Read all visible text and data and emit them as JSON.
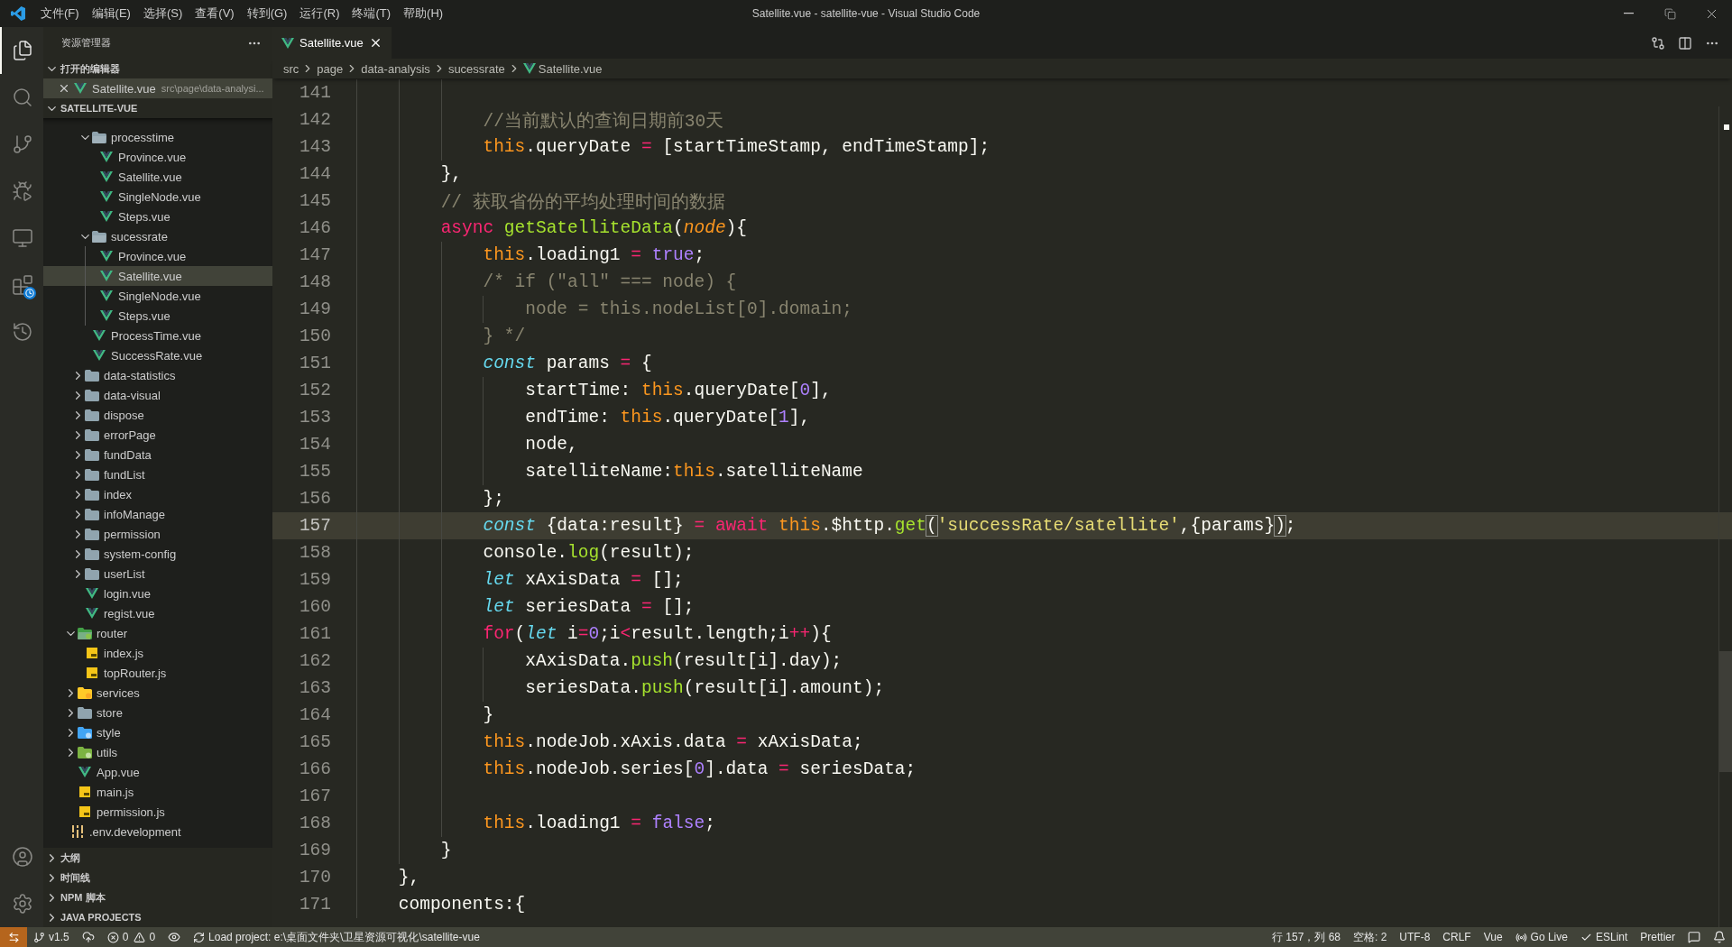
{
  "window": {
    "title": "Satellite.vue - satellite-vue - Visual Studio Code"
  },
  "menu": [
    "文件(F)",
    "编辑(E)",
    "选择(S)",
    "查看(V)",
    "转到(G)",
    "运行(R)",
    "终端(T)",
    "帮助(H)"
  ],
  "activity_bar": [
    {
      "kind": "explorer",
      "selected": true
    },
    {
      "kind": "search",
      "selected": false
    },
    {
      "kind": "scm",
      "selected": false
    },
    {
      "kind": "debug",
      "selected": false
    },
    {
      "kind": "remote",
      "selected": false
    },
    {
      "kind": "extensions",
      "selected": false
    },
    {
      "kind": "history",
      "selected": false
    }
  ],
  "sidebar": {
    "title": "资源管理器",
    "open_editors": {
      "label": "打开的编辑器",
      "expanded": true,
      "items": [
        {
          "name": "Satellite.vue",
          "path": "src\\page\\data-analysi...",
          "kind": "vue",
          "selected": true
        }
      ]
    },
    "project": {
      "label": "SATELLITE-VUE",
      "expanded": true
    },
    "tree": [
      {
        "children": [
          {
            "children": [
              {
                "children": [
                  {
                    "name": "processtime",
                    "kind": "folder",
                    "expanded": true,
                    "selected": false,
                    "children": [
                      {
                        "name": "Province.vue",
                        "kind": "vue",
                        "selected": false
                      },
                      {
                        "name": "Satellite.vue",
                        "kind": "vue",
                        "selected": false
                      },
                      {
                        "name": "SingleNode.vue",
                        "kind": "vue",
                        "selected": false
                      },
                      {
                        "name": "Steps.vue",
                        "kind": "vue",
                        "selected": false
                      }
                    ]
                  },
                  {
                    "name": "sucessrate",
                    "kind": "folder",
                    "expanded": true,
                    "selected": false,
                    "children": [
                      {
                        "name": "Province.vue",
                        "kind": "vue",
                        "selected": false
                      },
                      {
                        "name": "Satellite.vue",
                        "kind": "vue",
                        "selected": true
                      },
                      {
                        "name": "SingleNode.vue",
                        "kind": "vue",
                        "selected": false
                      },
                      {
                        "name": "Steps.vue",
                        "kind": "vue",
                        "selected": false
                      }
                    ]
                  },
                  {
                    "name": "ProcessTime.vue",
                    "kind": "vue",
                    "selected": false
                  },
                  {
                    "name": "SuccessRate.vue",
                    "kind": "vue",
                    "selected": false
                  }
                ]
              },
              {
                "name": "data-statistics",
                "kind": "folder",
                "expanded": false,
                "selected": false
              },
              {
                "name": "data-visual",
                "kind": "folder",
                "expanded": false,
                "selected": false
              },
              {
                "name": "dispose",
                "kind": "folder",
                "expanded": false,
                "selected": false
              },
              {
                "name": "errorPage",
                "kind": "folder",
                "expanded": false,
                "selected": false
              },
              {
                "name": "fundData",
                "kind": "folder",
                "expanded": false,
                "selected": false
              },
              {
                "name": "fundList",
                "kind": "folder",
                "expanded": false,
                "selected": false
              },
              {
                "name": "index",
                "kind": "folder",
                "expanded": false,
                "selected": false
              },
              {
                "name": "infoManage",
                "kind": "folder",
                "expanded": false,
                "selected": false
              },
              {
                "name": "permission",
                "kind": "folder",
                "expanded": false,
                "selected": false
              },
              {
                "name": "system-config",
                "kind": "folder",
                "expanded": false,
                "selected": false
              },
              {
                "name": "userList",
                "kind": "folder",
                "expanded": false,
                "selected": false
              },
              {
                "name": "login.vue",
                "kind": "vue",
                "selected": false
              },
              {
                "name": "regist.vue",
                "kind": "vue",
                "selected": false
              }
            ]
          },
          {
            "name": "router",
            "kind": "folder-router",
            "expanded": true,
            "selected": false,
            "children": [
              {
                "name": "index.js",
                "kind": "js",
                "selected": false
              },
              {
                "name": "topRouter.js",
                "kind": "js",
                "selected": false
              }
            ]
          },
          {
            "name": "services",
            "kind": "folder-services",
            "expanded": false,
            "selected": false
          },
          {
            "name": "store",
            "kind": "folder",
            "expanded": false,
            "selected": false
          },
          {
            "name": "style",
            "kind": "folder-style",
            "expanded": false,
            "selected": false
          },
          {
            "name": "utils",
            "kind": "folder-utils",
            "expanded": false,
            "selected": false
          },
          {
            "name": "App.vue",
            "kind": "vue",
            "selected": false
          },
          {
            "name": "main.js",
            "kind": "js",
            "selected": false
          },
          {
            "name": "permission.js",
            "kind": "js",
            "selected": false
          }
        ]
      },
      {
        "name": ".env.development",
        "kind": "env",
        "selected": false
      }
    ],
    "panels": [
      {
        "label": "大纲",
        "expanded": false
      },
      {
        "label": "时间线",
        "expanded": false
      },
      {
        "label": "NPM 脚本",
        "expanded": false
      },
      {
        "label": "JAVA PROJECTS",
        "expanded": false
      }
    ]
  },
  "tabs": [
    {
      "label": "Satellite.vue",
      "kind": "vue",
      "selected": true
    }
  ],
  "breadcrumb": [
    {
      "label": "src"
    },
    {
      "label": "page"
    },
    {
      "label": "data-analysis"
    },
    {
      "label": "sucessrate"
    },
    {
      "label": "Satellite.vue",
      "kind": "vue"
    }
  ],
  "code": [
    {
      "number": "141",
      "current": false
    },
    {
      "number": "142",
      "current": false,
      "tokens": [
        {
          "kind": "comment",
          "text": "            //当前默认的查询日期前30天"
        }
      ]
    },
    {
      "number": "143",
      "current": false,
      "tokens": [
        {
          "kind": "this",
          "text": "            this"
        },
        {
          "kind": "plain",
          "text": ".queryDate "
        },
        {
          "kind": "keyword",
          "text": "="
        },
        {
          "kind": "plain",
          "text": " [startTimeStamp, endTimeStamp];"
        }
      ]
    },
    {
      "number": "144",
      "current": false,
      "tokens": [
        {
          "kind": "plain",
          "text": "        },"
        }
      ]
    },
    {
      "number": "145",
      "current": false,
      "tokens": [
        {
          "kind": "comment",
          "text": "        // 获取省份的平均处理时间的数据"
        }
      ]
    },
    {
      "number": "146",
      "current": false,
      "tokens": [
        {
          "kind": "keyword",
          "text": "        async"
        },
        {
          "kind": "function",
          "text": " getSatelliteData"
        },
        {
          "kind": "plain",
          "text": "("
        },
        {
          "kind": "param",
          "text": "node"
        },
        {
          "kind": "plain",
          "text": "){"
        }
      ]
    },
    {
      "number": "147",
      "current": false,
      "tokens": [
        {
          "kind": "this",
          "text": "            this"
        },
        {
          "kind": "plain",
          "text": ".loading1 "
        },
        {
          "kind": "keyword",
          "text": "="
        },
        {
          "kind": "constant",
          "text": " true"
        },
        {
          "kind": "plain",
          "text": ";"
        }
      ]
    },
    {
      "number": "148",
      "current": false,
      "tokens": [
        {
          "kind": "comment",
          "text": "            /* if (\"all\" === node) {"
        }
      ]
    },
    {
      "number": "149",
      "current": false,
      "tokens": [
        {
          "kind": "comment",
          "text": "                node = this.nodeList[0].domain;"
        }
      ]
    },
    {
      "number": "150",
      "current": false,
      "tokens": [
        {
          "kind": "comment",
          "text": "            } */"
        }
      ]
    },
    {
      "number": "151",
      "current": false,
      "tokens": [
        {
          "kind": "storage",
          "text": "            const"
        },
        {
          "kind": "plain",
          "text": " params "
        },
        {
          "kind": "keyword",
          "text": "="
        },
        {
          "kind": "plain",
          "text": " {"
        }
      ]
    },
    {
      "number": "152",
      "current": false,
      "tokens": [
        {
          "kind": "plain",
          "text": "                startTime: "
        },
        {
          "kind": "this",
          "text": "this"
        },
        {
          "kind": "plain",
          "text": ".queryDate["
        },
        {
          "kind": "constant",
          "text": "0"
        },
        {
          "kind": "plain",
          "text": "],"
        }
      ]
    },
    {
      "number": "153",
      "current": false,
      "tokens": [
        {
          "kind": "plain",
          "text": "                endTime: "
        },
        {
          "kind": "this",
          "text": "this"
        },
        {
          "kind": "plain",
          "text": ".queryDate["
        },
        {
          "kind": "constant",
          "text": "1"
        },
        {
          "kind": "plain",
          "text": "],"
        }
      ]
    },
    {
      "number": "154",
      "current": false,
      "tokens": [
        {
          "kind": "plain",
          "text": "                node,"
        }
      ]
    },
    {
      "number": "155",
      "current": false,
      "tokens": [
        {
          "kind": "plain",
          "text": "                satelliteName:"
        },
        {
          "kind": "this",
          "text": "this"
        },
        {
          "kind": "plain",
          "text": ".satelliteName"
        }
      ]
    },
    {
      "number": "156",
      "current": false,
      "tokens": [
        {
          "kind": "plain",
          "text": "            };"
        }
      ]
    },
    {
      "number": "157",
      "current": true,
      "tokens": [
        {
          "kind": "storage",
          "text": "            const"
        },
        {
          "kind": "plain",
          "text": " {data:result} "
        },
        {
          "kind": "keyword",
          "text": "="
        },
        {
          "kind": "keyword",
          "text": " await"
        },
        {
          "kind": "this",
          "text": " this"
        },
        {
          "kind": "plain",
          "text": ".$http."
        },
        {
          "kind": "function",
          "text": "get"
        },
        {
          "kind": "bracket",
          "text": "("
        },
        {
          "kind": "string",
          "text": "'successRate/satellite'"
        },
        {
          "kind": "plain",
          "text": ",{params}"
        },
        {
          "kind": "bracket",
          "text": ")"
        },
        {
          "kind": "plain",
          "text": ";"
        }
      ]
    },
    {
      "number": "158",
      "current": false,
      "tokens": [
        {
          "kind": "plain",
          "text": "            console."
        },
        {
          "kind": "function",
          "text": "log"
        },
        {
          "kind": "plain",
          "text": "(result);"
        }
      ]
    },
    {
      "number": "159",
      "current": false,
      "tokens": [
        {
          "kind": "storage",
          "text": "            let"
        },
        {
          "kind": "plain",
          "text": " xAxisData "
        },
        {
          "kind": "keyword",
          "text": "="
        },
        {
          "kind": "plain",
          "text": " [];"
        }
      ]
    },
    {
      "number": "160",
      "current": false,
      "tokens": [
        {
          "kind": "storage",
          "text": "            let"
        },
        {
          "kind": "plain",
          "text": " seriesData "
        },
        {
          "kind": "keyword",
          "text": "="
        },
        {
          "kind": "plain",
          "text": " [];"
        }
      ]
    },
    {
      "number": "161",
      "current": false,
      "tokens": [
        {
          "kind": "keyword",
          "text": "            for"
        },
        {
          "kind": "plain",
          "text": "("
        },
        {
          "kind": "storage",
          "text": "let"
        },
        {
          "kind": "plain",
          "text": " i"
        },
        {
          "kind": "keyword",
          "text": "="
        },
        {
          "kind": "constant",
          "text": "0"
        },
        {
          "kind": "plain",
          "text": ";i"
        },
        {
          "kind": "keyword",
          "text": "<"
        },
        {
          "kind": "plain",
          "text": "result.length;i"
        },
        {
          "kind": "keyword",
          "text": "++"
        },
        {
          "kind": "plain",
          "text": "){"
        }
      ]
    },
    {
      "number": "162",
      "current": false,
      "tokens": [
        {
          "kind": "plain",
          "text": "                xAxisData."
        },
        {
          "kind": "function",
          "text": "push"
        },
        {
          "kind": "plain",
          "text": "(result[i].day);"
        }
      ]
    },
    {
      "number": "163",
      "current": false,
      "tokens": [
        {
          "kind": "plain",
          "text": "                seriesData."
        },
        {
          "kind": "function",
          "text": "push"
        },
        {
          "kind": "plain",
          "text": "(result[i].amount);"
        }
      ]
    },
    {
      "number": "164",
      "current": false,
      "tokens": [
        {
          "kind": "plain",
          "text": "            }"
        }
      ]
    },
    {
      "number": "165",
      "current": false,
      "tokens": [
        {
          "kind": "this",
          "text": "            this"
        },
        {
          "kind": "plain",
          "text": ".nodeJob.xAxis.data "
        },
        {
          "kind": "keyword",
          "text": "="
        },
        {
          "kind": "plain",
          "text": " xAxisData;"
        }
      ]
    },
    {
      "number": "166",
      "current": false,
      "tokens": [
        {
          "kind": "this",
          "text": "            this"
        },
        {
          "kind": "plain",
          "text": ".nodeJob.series["
        },
        {
          "kind": "constant",
          "text": "0"
        },
        {
          "kind": "plain",
          "text": "].data "
        },
        {
          "kind": "keyword",
          "text": "="
        },
        {
          "kind": "plain",
          "text": " seriesData;"
        }
      ]
    },
    {
      "number": "167",
      "current": false
    },
    {
      "number": "168",
      "current": false,
      "tokens": [
        {
          "kind": "this",
          "text": "            this"
        },
        {
          "kind": "plain",
          "text": ".loading1 "
        },
        {
          "kind": "keyword",
          "text": "="
        },
        {
          "kind": "constant",
          "text": " false"
        },
        {
          "kind": "plain",
          "text": ";"
        }
      ]
    },
    {
      "number": "169",
      "current": false,
      "tokens": [
        {
          "kind": "plain",
          "text": "        }"
        }
      ]
    },
    {
      "number": "170",
      "current": false,
      "tokens": [
        {
          "kind": "plain",
          "text": "    },"
        }
      ]
    },
    {
      "number": "171",
      "current": false,
      "tokens": [
        {
          "kind": "plain",
          "text": "    components:{"
        }
      ]
    }
  ],
  "status_bar": {
    "left": [
      {
        "kind": "remote"
      },
      {
        "kind": "branch",
        "text": "v1.5"
      },
      {
        "kind": "sync"
      },
      {
        "kind": "errors",
        "text": "0"
      },
      {
        "kind": "warnings",
        "text": "0"
      },
      {
        "kind": "watch"
      },
      {
        "kind": "loading",
        "text": "Load project: e:\\桌面文件夹\\卫星资源可视化\\satellite-vue"
      }
    ],
    "right": [
      {
        "kind": "text",
        "text": "行 157，列 68"
      },
      {
        "kind": "text",
        "text": "空格: 2"
      },
      {
        "kind": "text",
        "text": "UTF-8"
      },
      {
        "kind": "text",
        "text": "CRLF"
      },
      {
        "kind": "text",
        "text": "Vue"
      },
      {
        "kind": "golive",
        "text": "Go Live"
      },
      {
        "kind": "check",
        "text": "ESLint"
      },
      {
        "kind": "text",
        "text": "Prettier"
      },
      {
        "kind": "feedback"
      },
      {
        "kind": "bell"
      }
    ]
  }
}
